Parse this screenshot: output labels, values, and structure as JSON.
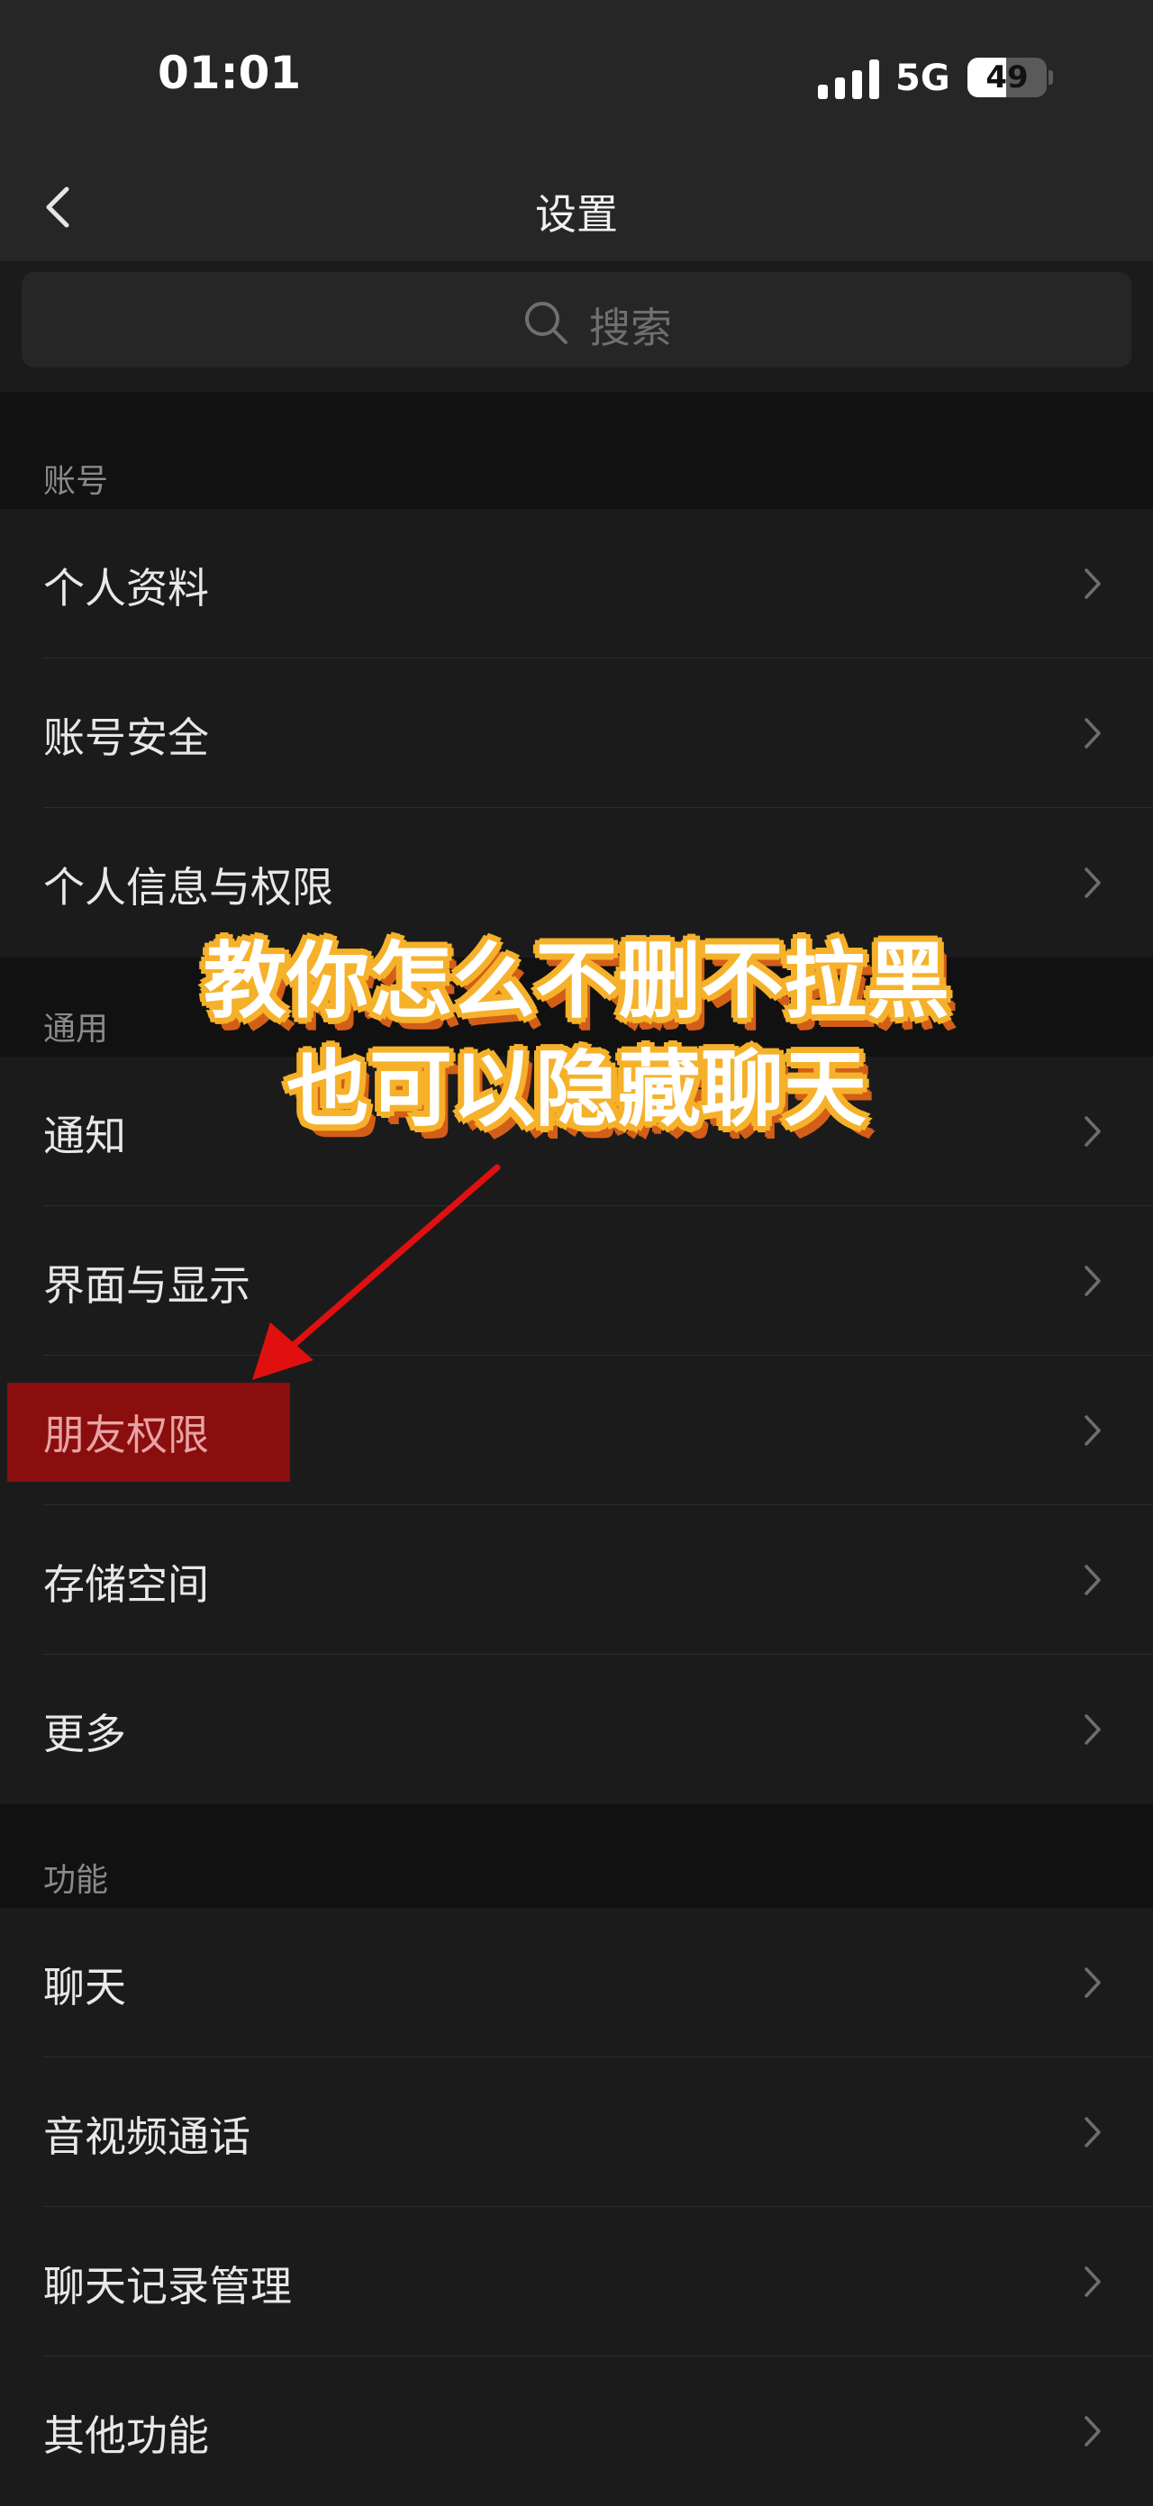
{
  "status_bar": {
    "time": "01:01",
    "network": "5G",
    "battery": "49",
    "battery_level": 0.49
  },
  "nav": {
    "title": "设置"
  },
  "search": {
    "placeholder": "搜索"
  },
  "sections": {
    "account": {
      "header": "账号",
      "items": [
        "个人资料",
        "账号安全",
        "个人信息与权限"
      ]
    },
    "general": {
      "header": "通用",
      "items": [
        "通知",
        "界面与显示",
        "朋友权限",
        "存储空间",
        "更多"
      ]
    },
    "features": {
      "header": "功能",
      "items": [
        "聊天",
        "音视频通话",
        "聊天记录管理",
        "其他功能"
      ]
    }
  },
  "overlay": {
    "line1": "教你怎么不删不拉黑",
    "line2": "也可以隐藏聊天"
  },
  "colors": {
    "highlight": "#8a0e0e",
    "arrow": "#e01010",
    "caption_outline": "#f6b12a"
  }
}
